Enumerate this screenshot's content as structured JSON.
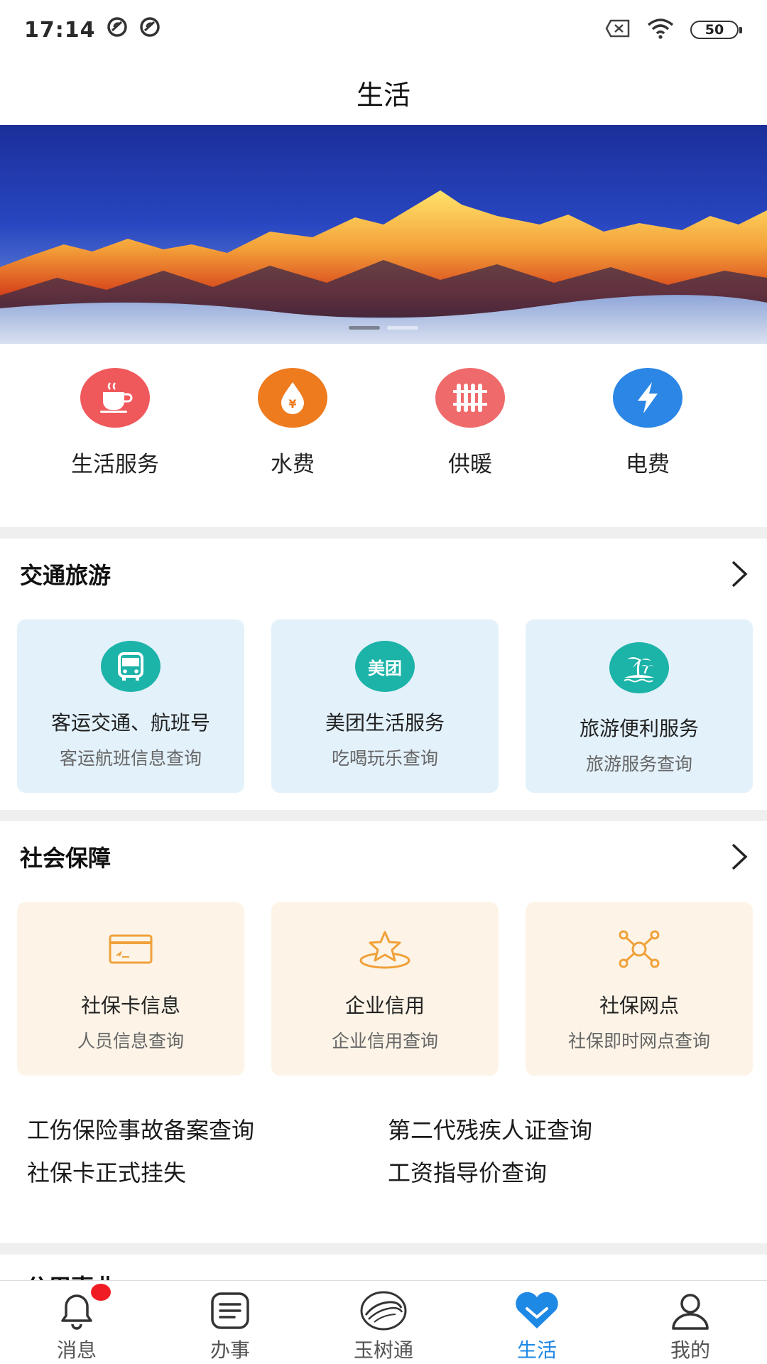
{
  "status_bar": {
    "time": "17:14",
    "left_icons": [
      "notification-icon",
      "notification-icon"
    ],
    "right_icons": [
      "no-sim-icon",
      "wifi-icon",
      "battery-icon"
    ],
    "battery": "50"
  },
  "header": {
    "title": "生活"
  },
  "banner": {
    "pages": 2,
    "active_page": 1
  },
  "quick_services": [
    {
      "label": "生活服务",
      "icon": "coffee-cup-icon",
      "color": "#f0595c"
    },
    {
      "label": "水费",
      "icon": "water-drop-icon",
      "color": "#ee7b1e"
    },
    {
      "label": "供暖",
      "icon": "radiator-icon",
      "color": "#ef6b6b"
    },
    {
      "label": "电费",
      "icon": "lightning-icon",
      "color": "#2b86e6"
    }
  ],
  "transport": {
    "title": "交通旅游",
    "cards": [
      {
        "title": "客运交通、航班号",
        "subtitle": "客运航班信息查询",
        "icon": "bus-icon"
      },
      {
        "title": "美团生活服务",
        "subtitle": "吃喝玩乐查询",
        "icon": "meituan-icon",
        "icon_text": "美团"
      },
      {
        "title": "旅游便利服务",
        "subtitle": "旅游服务查询",
        "icon": "island-palm-icon"
      }
    ]
  },
  "social": {
    "title": "社会保障",
    "cards": [
      {
        "title": "社保卡信息",
        "subtitle": "人员信息查询",
        "icon": "id-card-icon"
      },
      {
        "title": "企业信用",
        "subtitle": "企业信用查询",
        "icon": "star-icon"
      },
      {
        "title": "社保网点",
        "subtitle": "社保即时网点查询",
        "icon": "network-icon"
      }
    ],
    "links": [
      "工伤保险事故备案查询",
      "第二代残疾人证查询",
      "社保卡正式挂失",
      "工资指导价查询"
    ]
  },
  "next_section": {
    "title": "公用事业"
  },
  "tabs": [
    {
      "label": "消息",
      "icon": "bell-icon",
      "active": false,
      "badge": true
    },
    {
      "label": "办事",
      "icon": "document-icon",
      "active": false,
      "badge": false
    },
    {
      "label": "玉树通",
      "icon": "app-logo-icon",
      "active": false,
      "badge": false
    },
    {
      "label": "生活",
      "icon": "heart-icon",
      "active": true,
      "badge": false
    },
    {
      "label": "我的",
      "icon": "profile-icon",
      "active": false,
      "badge": false
    }
  ],
  "colors": {
    "accent": "#1e88e5",
    "teal": "#1cb3a8",
    "card_blue": "#e3f1fb",
    "card_cream": "#fdf4e7",
    "icon_orange": "#f0a13a"
  }
}
